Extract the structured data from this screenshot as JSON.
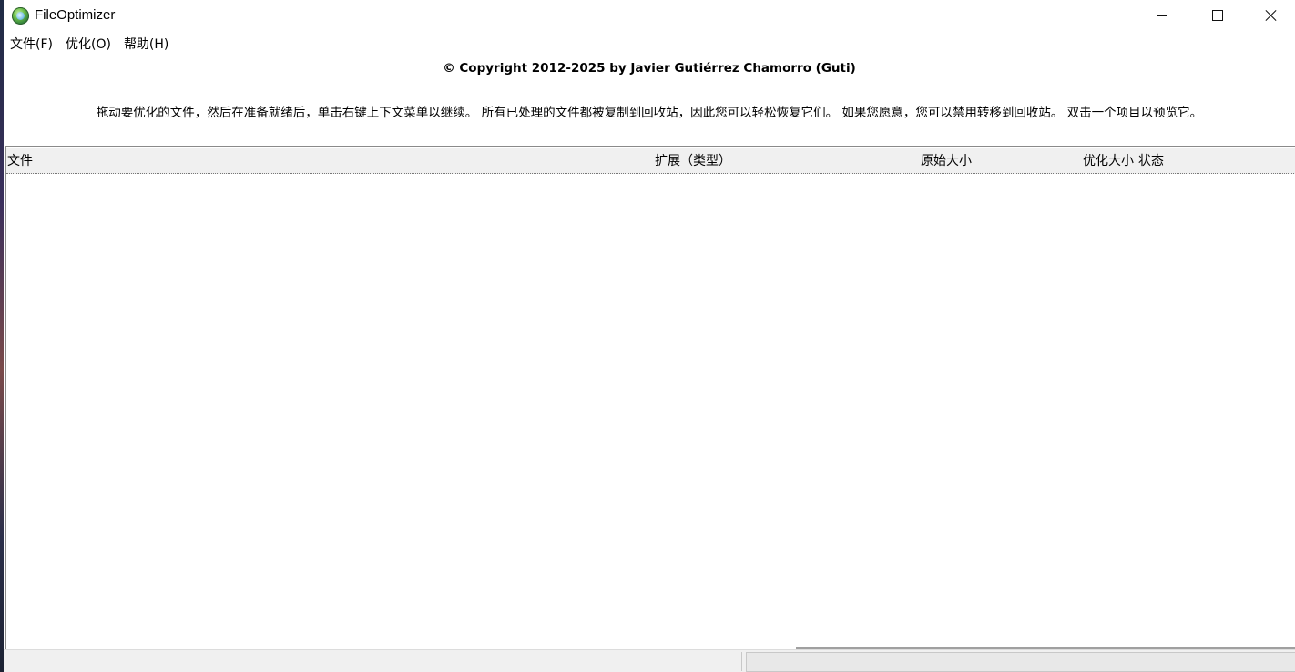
{
  "window": {
    "title": "FileOptimizer",
    "icon": "fileoptimizer-app-icon"
  },
  "menu": {
    "items": [
      {
        "label": "文件(F)"
      },
      {
        "label": "优化(O)"
      },
      {
        "label": "帮助(H)"
      }
    ]
  },
  "header": {
    "copyright": "© Copyright 2012-2025 by Javier Gutiérrez Chamorro (Guti)",
    "instructions": "拖动要优化的文件，然后在准备就绪后，单击右键上下文菜单以继续。 所有已处理的文件都被复制到回收站，因此您可以轻松恢复它们。 如果您愿意，您可以禁用转移到回收站。 双击一个项目以预览它。"
  },
  "list": {
    "columns": [
      {
        "label": "文件"
      },
      {
        "label": "扩展（类型）"
      },
      {
        "label": "原始大小"
      },
      {
        "label": "优化大小"
      },
      {
        "label": "状态"
      }
    ],
    "rows": []
  },
  "colors": {
    "header_bg": "#f0f0f0",
    "statusbar_bg": "#f0f0f0",
    "window_bg": "#ffffff"
  }
}
